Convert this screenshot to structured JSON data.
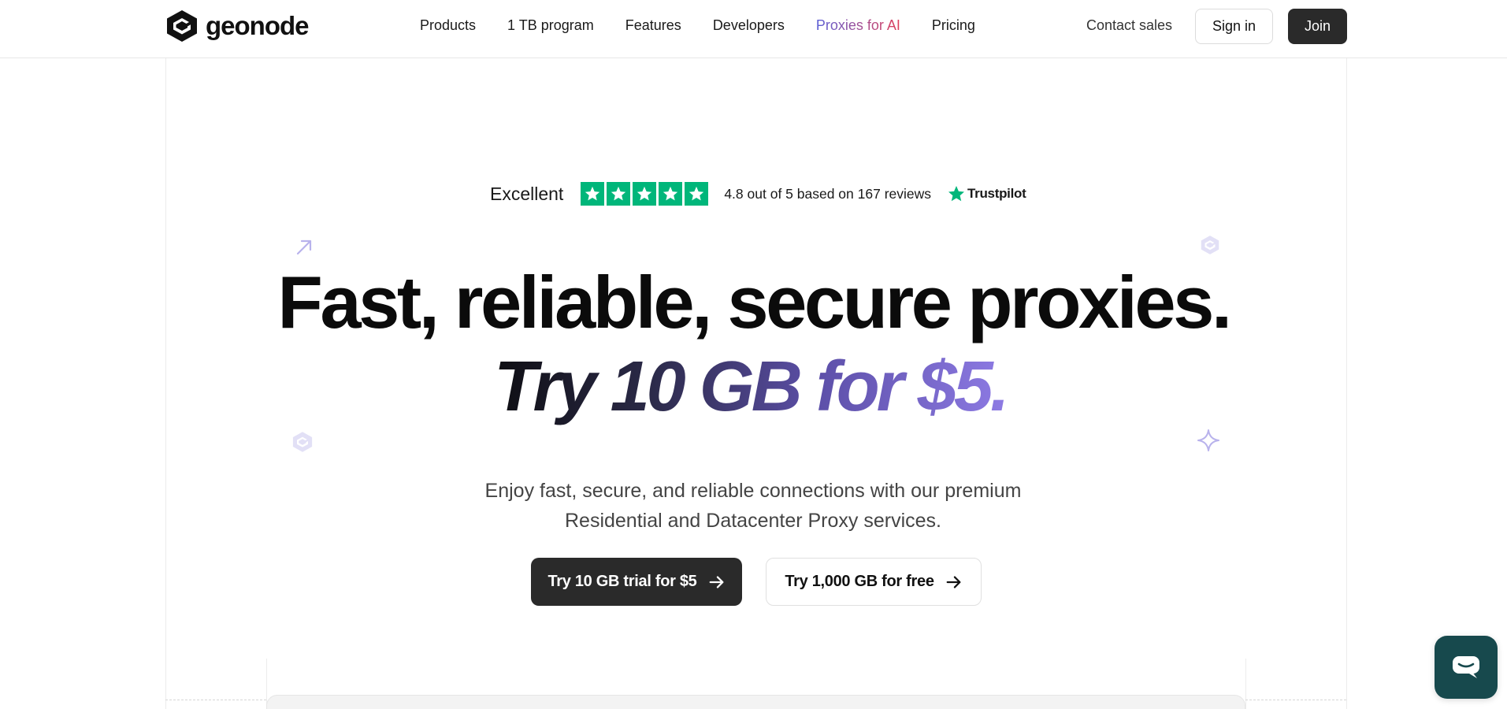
{
  "header": {
    "logo_text": "geonode",
    "nav": [
      {
        "label": "Products"
      },
      {
        "label": "1 TB program"
      },
      {
        "label": "Features"
      },
      {
        "label": "Developers"
      },
      {
        "label": "Proxies for AI"
      },
      {
        "label": "Pricing"
      }
    ],
    "contact_label": "Contact sales",
    "signin_label": "Sign in",
    "join_label": "Join"
  },
  "trustpilot": {
    "rating_word": "Excellent",
    "stars": 5,
    "summary": "4.8 out of 5 based on 167 reviews",
    "brand": "Trustpilot"
  },
  "hero": {
    "title": "Fast, reliable, secure proxies.",
    "subtitle": "Try 10 GB for $5.",
    "description": "Enjoy fast, secure, and reliable connections with our premium Residential and Datacenter Proxy services.",
    "primary_cta": "Try 10 GB trial for $5",
    "secondary_cta": "Try 1,000 GB for free"
  },
  "colors": {
    "trustpilot_green": "#00b67a",
    "dark_button": "#2a2a2a",
    "chat_bg": "#17494d",
    "accent_purple": "#8f7ce6"
  },
  "icons": {
    "logo": "geonode-logo-icon",
    "star": "star-icon",
    "arrow": "arrow-right-icon",
    "chat": "chat-icon"
  }
}
